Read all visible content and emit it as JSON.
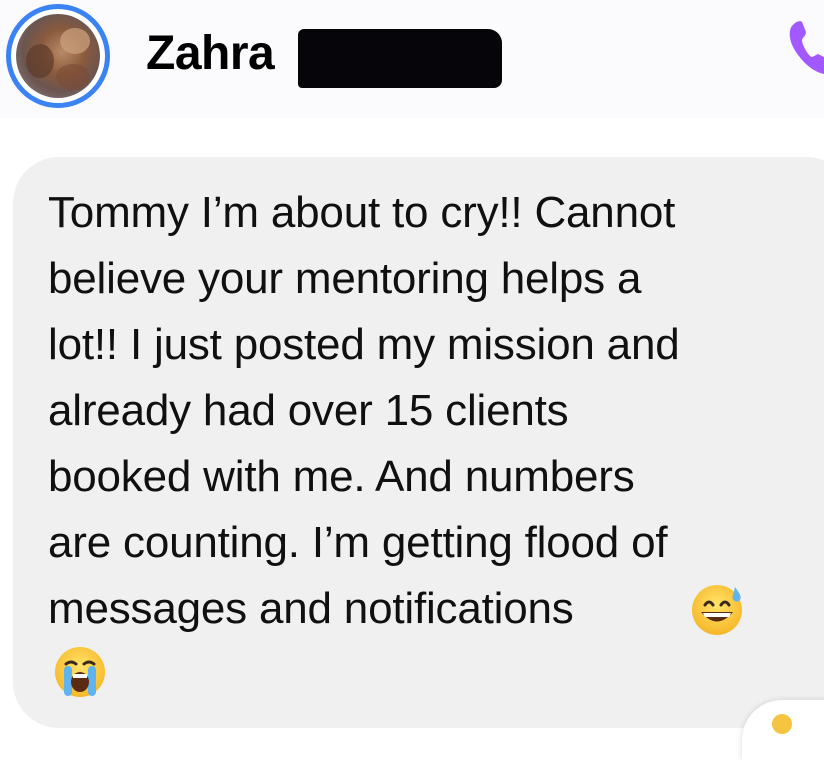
{
  "header": {
    "contact_name": "Zahra",
    "avatar_icon": "profile-photo",
    "call_icon": "phone-icon",
    "accent_color": "#3b83f5",
    "call_icon_color": "#a259ff"
  },
  "message": {
    "lines": [
      "Tommy I’m about to cry!! Cannot",
      "believe your mentoring helps a",
      "lot!! I just posted my mission and",
      "already had over 15 clients",
      "booked with me. And numbers",
      "are counting. I’m getting flood of",
      "messages and notifications"
    ],
    "emoji_inline": "grinning-face-with-sweat",
    "emoji_trailing": "loudly-crying-face",
    "bubble_color": "#f0f0f1"
  },
  "reaction": {
    "icon": "thumbs-up-reaction"
  }
}
